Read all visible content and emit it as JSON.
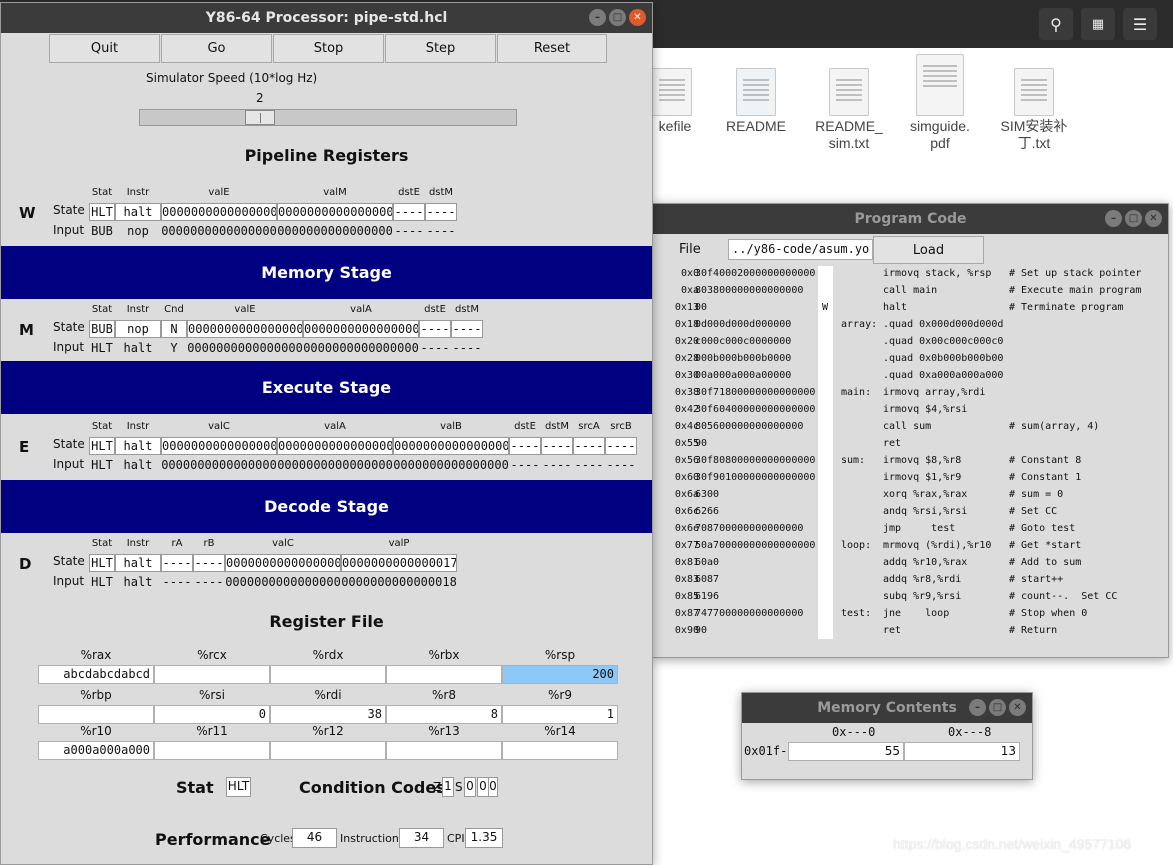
{
  "file_manager": {
    "files": [
      {
        "name": "kefile"
      },
      {
        "name": "README"
      },
      {
        "name": "README_\nsim.txt"
      },
      {
        "name": "simguide.\npdf"
      },
      {
        "name": "SIM安装补\n丁.txt"
      }
    ]
  },
  "sim_window": {
    "title": "Y86-64 Processor: pipe-std.hcl",
    "buttons": [
      "Quit",
      "Go",
      "Stop",
      "Step",
      "Reset"
    ],
    "speed_label": "Simulator Speed (10*log Hz)",
    "speed_value": "2",
    "pipeline_title": "Pipeline Registers",
    "W": {
      "letter": "W",
      "headers": [
        "Stat",
        "Instr",
        "valE",
        "valM",
        "dstE",
        "dstM"
      ],
      "state_label": "State",
      "input_label": "Input",
      "state": [
        "HLT",
        "halt",
        "0000000000000000",
        "0000000000000000",
        "----",
        "----"
      ],
      "input": [
        "BUB",
        "nop",
        "0000000000000000",
        "0000000000000000",
        "----",
        "----"
      ]
    },
    "memory_stage": "Memory Stage",
    "M": {
      "letter": "M",
      "headers": [
        "Stat",
        "Instr",
        "Cnd",
        "valE",
        "valA",
        "dstE",
        "dstM"
      ],
      "state_label": "State",
      "input_label": "Input",
      "state": [
        "BUB",
        "nop",
        "N",
        "0000000000000000",
        "0000000000000000",
        "----",
        "----"
      ],
      "input": [
        "HLT",
        "halt",
        "Y",
        "0000000000000000",
        "0000000000000000",
        "----",
        "----"
      ]
    },
    "execute_stage": "Execute Stage",
    "E": {
      "letter": "E",
      "headers": [
        "Stat",
        "Instr",
        "valC",
        "valA",
        "valB",
        "dstE",
        "dstM",
        "srcA",
        "srcB"
      ],
      "state_label": "State",
      "input_label": "Input",
      "state": [
        "HLT",
        "halt",
        "0000000000000000",
        "0000000000000000",
        "0000000000000000",
        "----",
        "----",
        "----",
        "----"
      ],
      "input": [
        "HLT",
        "halt",
        "0000000000000000",
        "0000000000000000",
        "0000000000000000",
        "----",
        "----",
        "----",
        "----"
      ]
    },
    "decode_stage": "Decode Stage",
    "D": {
      "letter": "D",
      "headers": [
        "Stat",
        "Instr",
        "rA",
        "rB",
        "valC",
        "valP"
      ],
      "state_label": "State",
      "input_label": "Input",
      "state": [
        "HLT",
        "halt",
        "----",
        "----",
        "0000000000000000",
        "0000000000000017"
      ],
      "input": [
        "HLT",
        "halt",
        "----",
        "----",
        "0000000000000000",
        "0000000000000018"
      ]
    },
    "register_file_title": "Register File",
    "registers": [
      [
        {
          "name": "%rax",
          "value": "abcdabcdabcd"
        },
        {
          "name": "%rcx",
          "value": ""
        },
        {
          "name": "%rdx",
          "value": ""
        },
        {
          "name": "%rbx",
          "value": ""
        },
        {
          "name": "%rsp",
          "value": "200"
        }
      ],
      [
        {
          "name": "%rbp",
          "value": ""
        },
        {
          "name": "%rsi",
          "value": "0"
        },
        {
          "name": "%rdi",
          "value": "38"
        },
        {
          "name": "%r8",
          "value": "8"
        },
        {
          "name": "%r9",
          "value": "1"
        }
      ],
      [
        {
          "name": "%r10",
          "value": "a000a000a000"
        },
        {
          "name": "%r11",
          "value": ""
        },
        {
          "name": "%r12",
          "value": ""
        },
        {
          "name": "%r13",
          "value": ""
        },
        {
          "name": "%r14",
          "value": ""
        }
      ]
    ],
    "stat_label": "Stat",
    "stat_value": "HLT",
    "cc_label": "Condition Codes",
    "cc": {
      "Z": "1",
      "S": "0",
      "O": "0"
    },
    "performance_label": "Performance",
    "cycles_label": "Cycles",
    "cycles": "46",
    "instructions_label": "Instructions",
    "instructions": "34",
    "cpi_label": "CPI",
    "cpi": "1.35"
  },
  "program_window": {
    "title": "Program Code",
    "file_label": "File",
    "file_value": "../y86-code/asum.yo",
    "load_label": "Load",
    "lines": [
      {
        "addr": "0x0",
        "code": "30f40002000000000000",
        "mark": "",
        "label": "",
        "instr": "irmovq stack, %rsp",
        "comment": "# Set up stack pointer"
      },
      {
        "addr": "0xa",
        "code": "803800000000000000",
        "mark": "",
        "label": "",
        "instr": "call main",
        "comment": "# Execute main program"
      },
      {
        "addr": "0x13",
        "code": "00",
        "mark": "W",
        "label": "",
        "instr": "halt",
        "comment": "# Terminate program"
      },
      {
        "addr": "0x18",
        "code": "0d000d000d000000",
        "mark": "",
        "label": "array:",
        "instr": ".quad 0x000d000d000d",
        "comment": ""
      },
      {
        "addr": "0x20",
        "code": "c000c000c0000000",
        "mark": "",
        "label": "",
        "instr": ".quad 0x00c000c000c0",
        "comment": ""
      },
      {
        "addr": "0x28",
        "code": "000b000b000b0000",
        "mark": "",
        "label": "",
        "instr": ".quad 0x0b000b000b00",
        "comment": ""
      },
      {
        "addr": "0x30",
        "code": "00a000a000a00000",
        "mark": "",
        "label": "",
        "instr": ".quad 0xa000a000a000",
        "comment": ""
      },
      {
        "addr": "0x38",
        "code": "30f71800000000000000",
        "mark": "",
        "label": "main:",
        "instr": "irmovq array,%rdi",
        "comment": ""
      },
      {
        "addr": "0x42",
        "code": "30f60400000000000000",
        "mark": "",
        "label": "",
        "instr": "irmovq $4,%rsi",
        "comment": ""
      },
      {
        "addr": "0x4c",
        "code": "805600000000000000",
        "mark": "",
        "label": "",
        "instr": "call sum",
        "comment": "# sum(array, 4)"
      },
      {
        "addr": "0x55",
        "code": "90",
        "mark": "",
        "label": "",
        "instr": "ret",
        "comment": ""
      },
      {
        "addr": "0x56",
        "code": "30f80800000000000000",
        "mark": "",
        "label": "sum:",
        "instr": "irmovq $8,%r8",
        "comment": "# Constant 8"
      },
      {
        "addr": "0x60",
        "code": "30f90100000000000000",
        "mark": "",
        "label": "",
        "instr": "irmovq $1,%r9",
        "comment": "# Constant 1"
      },
      {
        "addr": "0x6a",
        "code": "6300",
        "mark": "",
        "label": "",
        "instr": "xorq %rax,%rax",
        "comment": "# sum = 0"
      },
      {
        "addr": "0x6c",
        "code": "6266",
        "mark": "",
        "label": "",
        "instr": "andq %rsi,%rsi",
        "comment": "# Set CC"
      },
      {
        "addr": "0x6e",
        "code": "708700000000000000",
        "mark": "",
        "label": "",
        "instr": "jmp     test",
        "comment": "# Goto test"
      },
      {
        "addr": "0x77",
        "code": "50a70000000000000000",
        "mark": "",
        "label": "loop:",
        "instr": "mrmovq (%rdi),%r10",
        "comment": "# Get *start"
      },
      {
        "addr": "0x81",
        "code": "60a0",
        "mark": "",
        "label": "",
        "instr": "addq %r10,%rax",
        "comment": "# Add to sum"
      },
      {
        "addr": "0x83",
        "code": "6087",
        "mark": "",
        "label": "",
        "instr": "addq %r8,%rdi",
        "comment": "# start++"
      },
      {
        "addr": "0x85",
        "code": "6196",
        "mark": "",
        "label": "",
        "instr": "subq %r9,%rsi",
        "comment": "# count--.  Set CC"
      },
      {
        "addr": "0x87",
        "code": "747700000000000000",
        "mark": "",
        "label": "test:",
        "instr": "jne    loop",
        "comment": "# Stop when 0"
      },
      {
        "addr": "0x90",
        "code": "90",
        "mark": "",
        "label": "",
        "instr": "ret",
        "comment": "# Return"
      }
    ]
  },
  "memory_window": {
    "title": "Memory Contents",
    "col_headers": [
      "0x---0",
      "0x---8"
    ],
    "row_label": "0x01f-",
    "values": [
      "55",
      "13"
    ]
  },
  "watermark": "https://blog.csdn.net/weixin_49577106"
}
